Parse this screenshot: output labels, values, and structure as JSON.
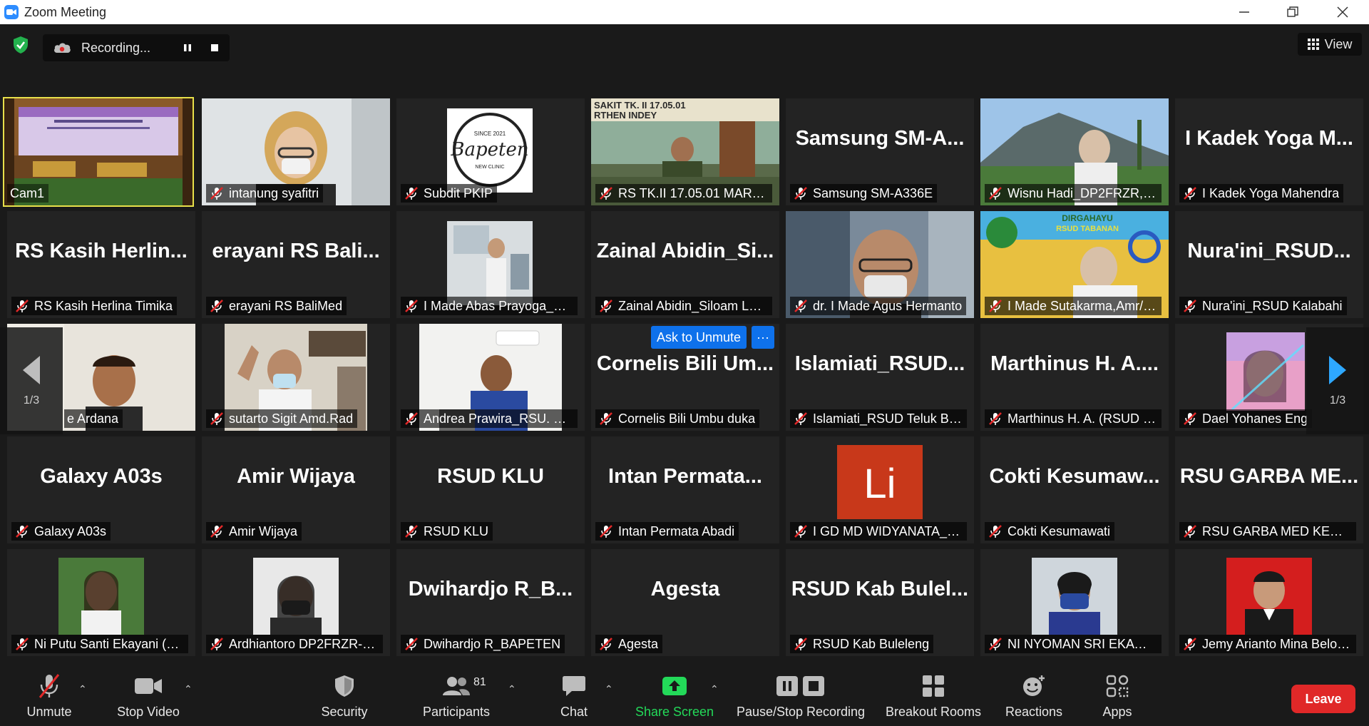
{
  "window": {
    "title": "Zoom Meeting"
  },
  "recording": {
    "status": "Recording..."
  },
  "view_button": {
    "label": "View"
  },
  "tiles": {
    "r1": [
      {
        "label": "Cam1"
      },
      {
        "label": "intanung syafitri"
      },
      {
        "label": "Subdit PKIP",
        "logo_text": "Bapeten",
        "logo_top": "SINCE 2021",
        "logo_bottom": "NEW CLINIC"
      },
      {
        "label": "RS TK.II 17.05.01 MARTHE...",
        "banner": "SAKIT TK. II 17.05.01",
        "banner2": "RTHEN INDEY"
      },
      {
        "label": "Samsung SM-A336E",
        "bigname": "Samsung SM-A..."
      },
      {
        "label": "Wisnu Hadi_DP2FRZR, BA..."
      },
      {
        "label": "I Kadek Yoga Mahendra",
        "bigname": "I Kadek Yoga M..."
      }
    ],
    "r2": [
      {
        "label": "RS Kasih Herlina Timika",
        "bigname": "RS Kasih Herlin..."
      },
      {
        "label": "erayani RS BaliMed",
        "bigname": "erayani RS Bali..."
      },
      {
        "label": "I Made Abas Prayoga_RS..."
      },
      {
        "label": "Zainal Abidin_Siloam Lab...",
        "bigname": "Zainal Abidin_Si..."
      },
      {
        "label": "dr. I Made Agus Hermanto"
      },
      {
        "label": "I Made Sutakarma,Amr/R...",
        "banner": "DIRGAHAYU",
        "banner2": "RSUD TABANAN"
      },
      {
        "label": "Nura'ini_RSUD Kalabahi",
        "bigname": "Nura'ini_RSUD..."
      }
    ],
    "r3": [
      {
        "label": "e Ardana"
      },
      {
        "label": "sutarto Sigit Amd.Rad"
      },
      {
        "label": "Andrea Prawira_RSU. Sur..."
      },
      {
        "label": "Cornelis Bili Umbu duka",
        "bigname": "Cornelis Bili Um..."
      },
      {
        "label": "Islamiati_RSUD Teluk Bint...",
        "bigname": "Islamiati_RSUD..."
      },
      {
        "label": "Marthinus H. A. (RSUD KA...",
        "bigname": "Marthinus H. A...."
      },
      {
        "label": "Dael Yohanes Eng"
      }
    ],
    "r4": [
      {
        "label": "Galaxy A03s",
        "bigname": "Galaxy A03s"
      },
      {
        "label": "Amir Wijaya",
        "bigname": "Amir Wijaya"
      },
      {
        "label": "RSUD KLU",
        "bigname": "RSUD KLU"
      },
      {
        "label": "Intan Permata Abadi",
        "bigname": "Intan Permata..."
      },
      {
        "label": "I GD MD WIDYANATA_RS ...",
        "logo_text": "Li"
      },
      {
        "label": "Cokti Kesumawati",
        "bigname": "Cokti Kesumaw..."
      },
      {
        "label": "RSU GARBA MED KEROB...",
        "bigname": "RSU GARBA ME..."
      }
    ],
    "r5": [
      {
        "label": "Ni Putu Santi Ekayani (La..."
      },
      {
        "label": "Ardhiantoro DP2FRZR-BA..."
      },
      {
        "label": "Dwihardjo R_BAPETEN",
        "bigname": "Dwihardjo R_B..."
      },
      {
        "label": "Agesta",
        "bigname": "Agesta"
      },
      {
        "label": "RSUD Kab Buleleng",
        "bigname": "RSUD Kab Bulel..."
      },
      {
        "label": "NI NYOMAN SRI EKAWAT..."
      },
      {
        "label": "Jemy Arianto Mina Belo -..."
      }
    ]
  },
  "ask_unmute": {
    "label": "Ask to Unmute",
    "more": "···"
  },
  "pagination": {
    "left": "1/3",
    "right": "1/3"
  },
  "toolbar": {
    "unmute": "Unmute",
    "stop_video": "Stop Video",
    "security": "Security",
    "participants": "Participants",
    "participants_count": "81",
    "chat": "Chat",
    "share_screen": "Share Screen",
    "pause_stop_recording": "Pause/Stop Recording",
    "breakout_rooms": "Breakout Rooms",
    "reactions": "Reactions",
    "apps": "Apps",
    "leave": "Leave"
  },
  "colors": {
    "background": "#1a1a1a",
    "tile": "#232323",
    "active_speaker_border": "#e8e04a",
    "ask_unmute": "#0e71eb",
    "share_screen": "#23d959",
    "leave": "#e02828",
    "mute_icon": "#e02828"
  }
}
